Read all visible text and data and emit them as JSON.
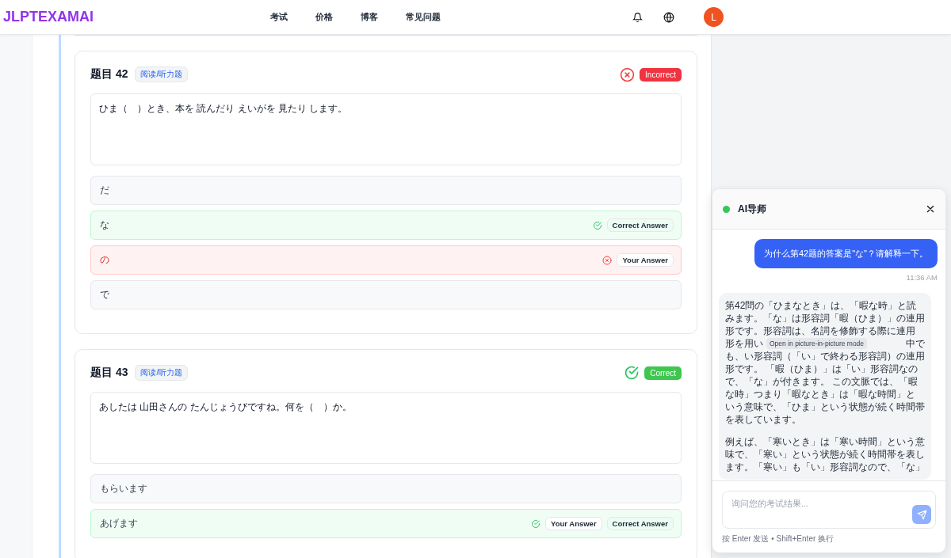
{
  "header": {
    "logo": "JLPTEXAMAI",
    "nav": [
      "考试",
      "价格",
      "博客",
      "常见问题"
    ],
    "avatar": "L"
  },
  "questions": [
    {
      "title": "题目 42",
      "tag": "阅读/听力题",
      "kind": "incorrect",
      "result_label": "Incorrect",
      "text": "ひま（　）とき、本を 読んだり えいがを 見たり します。",
      "options": [
        {
          "text": "だ",
          "kind": "neutral"
        },
        {
          "text": "な",
          "kind": "correct",
          "badges": [
            {
              "label": "Correct Answer",
              "kind": "correct"
            }
          ]
        },
        {
          "text": "の",
          "kind": "wrong",
          "badges": [
            {
              "label": "Your Answer",
              "kind": "yours"
            }
          ]
        },
        {
          "text": "で",
          "kind": "neutral"
        }
      ]
    },
    {
      "title": "题目 43",
      "tag": "阅读/听力题",
      "kind": "correct",
      "result_label": "Correct",
      "text": "あしたは 山田さんの たんじょうびですね。何を（　）か。",
      "options": [
        {
          "text": "もらいます",
          "kind": "neutral"
        },
        {
          "text": "あげます",
          "kind": "correct",
          "badges": [
            {
              "label": "Your Answer",
              "kind": "yours"
            },
            {
              "label": "Correct Answer",
              "kind": "correct"
            }
          ]
        }
      ]
    }
  ],
  "chat": {
    "title": "AI导师",
    "online": true,
    "user_message": "为什么第42题的答案是\"な\"？请解释一下。",
    "time": "11:36 AM",
    "reply": [
      [
        {
          "parts": [
            "第42問の「ひまなとき」は、「暇な時」と読"
          ]
        },
        {
          "parts": [
            "みます。「な」は形容詞「暇（ひま）」の連用"
          ]
        },
        {
          "parts": [
            "形です。形容詞は、名詞を修飾する際に連用"
          ]
        },
        {
          "parts": [
            "形を用い",
            "中で"
          ],
          "tooltip": "Open in picture-in-picture mode"
        },
        {
          "parts": [
            "も、い形容詞（「い」で終わる形容詞）の連用"
          ]
        },
        {
          "parts": [
            "形です。 「暇（ひま）」は「い」形容詞なの"
          ]
        },
        {
          "parts": [
            "で、「な」が付きます。 この文脈では、「暇"
          ]
        },
        {
          "parts": [
            "な時」つまり「暇なとき」は「暇な時間」と"
          ]
        },
        {
          "parts": [
            "いう意味で、「ひま」という状態が続く時間帯"
          ]
        },
        {
          "parts": [
            "を表しています。"
          ]
        }
      ],
      [
        {
          "parts": [
            "例えば、「寒いとき」は「寒い時間」という意"
          ]
        },
        {
          "parts": [
            "味で、「寒い」という状態が続く時間帯を表し"
          ]
        },
        {
          "parts": [
            "ます。「寒い」も「い」形容詞なので、「な」"
          ]
        }
      ]
    ],
    "placeholder": "询问您的考试结果...",
    "hint": "按 Enter 发送 • Shift+Enter 换行"
  }
}
